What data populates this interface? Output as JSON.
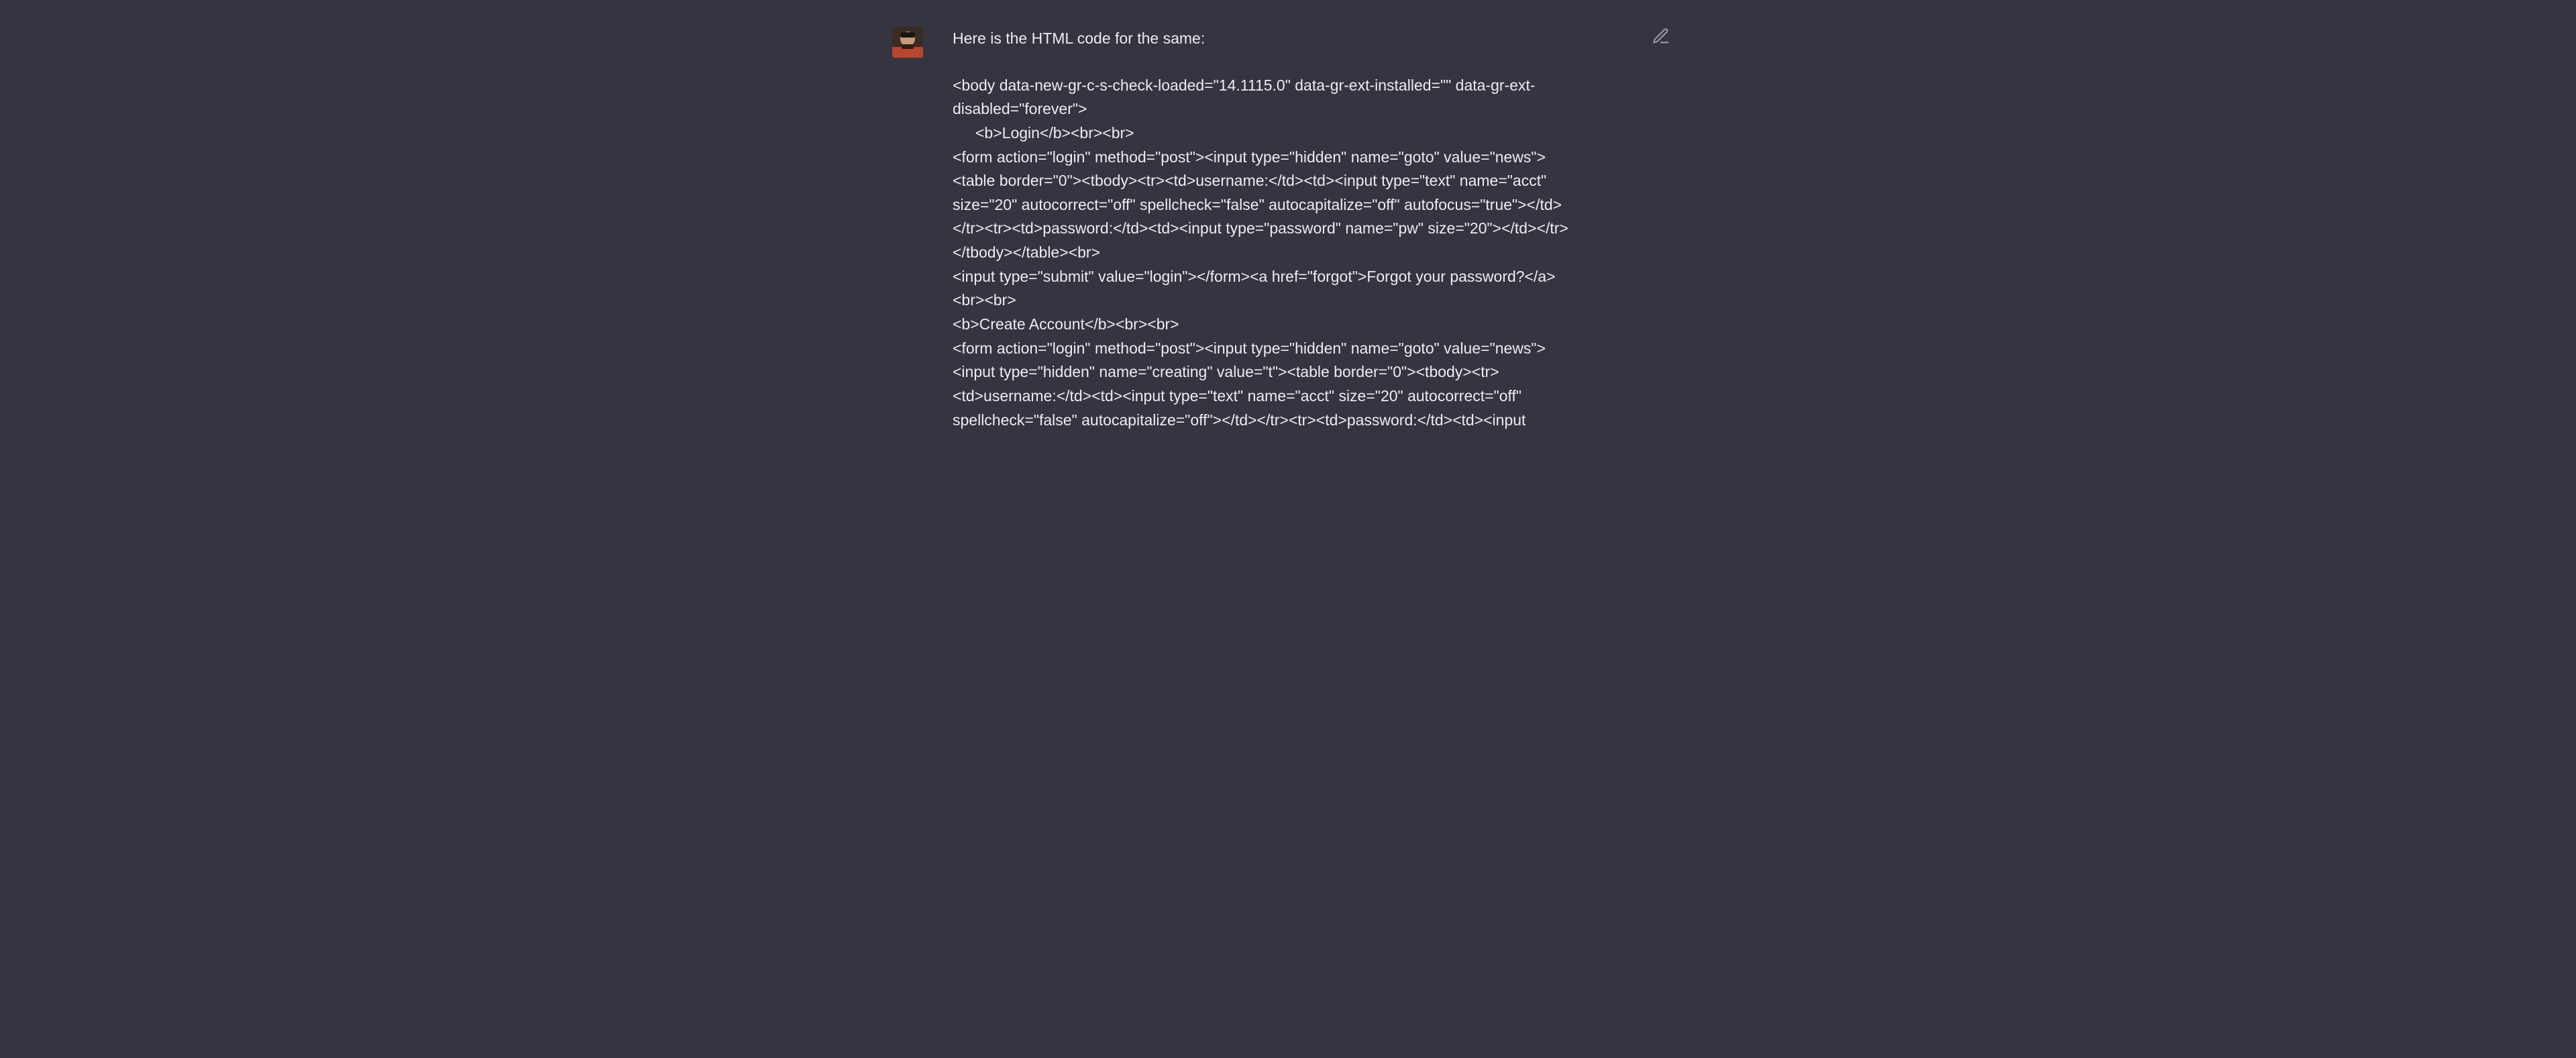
{
  "message": {
    "intro": "Here is the HTML code for the same:",
    "code_lines": {
      "l01": "<body data-new-gr-c-s-check-loaded=\"14.1115.0\" data-gr-ext-installed=\"\" data-gr-ext-disabled=\"forever\">",
      "l02": "<b>Login</b><br><br>",
      "l03": "<form action=\"login\" method=\"post\"><input type=\"hidden\" name=\"goto\" value=\"news\">",
      "l04": "<table border=\"0\"><tbody><tr><td>username:</td><td><input type=\"text\" name=\"acct\" size=\"20\" autocorrect=\"off\" spellcheck=\"false\" autocapitalize=\"off\" autofocus=\"true\"></td></tr><tr><td>password:</td><td><input type=\"password\" name=\"pw\" size=\"20\"></td></tr></tbody></table><br>",
      "l05": "<input type=\"submit\" value=\"login\"></form><a href=\"forgot\">Forgot your password?</a><br><br>",
      "l06": "<b>Create Account</b><br><br>",
      "l07": "<form action=\"login\" method=\"post\"><input type=\"hidden\" name=\"goto\" value=\"news\"><input type=\"hidden\" name=\"creating\" value=\"t\"><table border=\"0\"><tbody><tr><td>username:</td><td><input type=\"text\" name=\"acct\" size=\"20\" autocorrect=\"off\" spellcheck=\"false\" autocapitalize=\"off\"></td></tr><tr><td>password:</td><td><input"
    }
  },
  "avatar": {
    "name": "user-avatar"
  },
  "actions": {
    "edit": "edit"
  }
}
